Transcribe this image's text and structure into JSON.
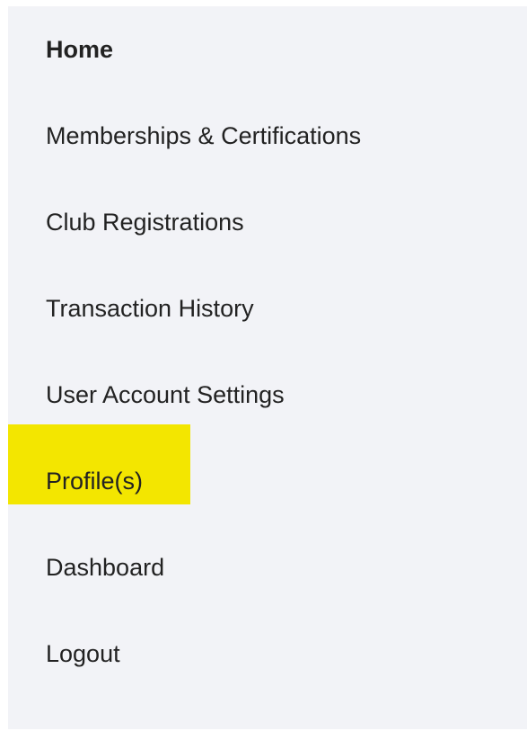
{
  "nav": {
    "items": [
      {
        "label": "Home",
        "bold": true
      },
      {
        "label": "Memberships & Certifications",
        "bold": false
      },
      {
        "label": "Club Registrations",
        "bold": false
      },
      {
        "label": "Transaction History",
        "bold": false
      },
      {
        "label": "User Account Settings",
        "bold": false
      },
      {
        "label": "Profile(s)",
        "bold": false,
        "highlighted": true
      },
      {
        "label": "Dashboard",
        "bold": false
      },
      {
        "label": "Logout",
        "bold": false
      }
    ]
  },
  "colors": {
    "panel_background": "#f2f3f7",
    "highlight": "#f3e600",
    "text": "#222222"
  }
}
